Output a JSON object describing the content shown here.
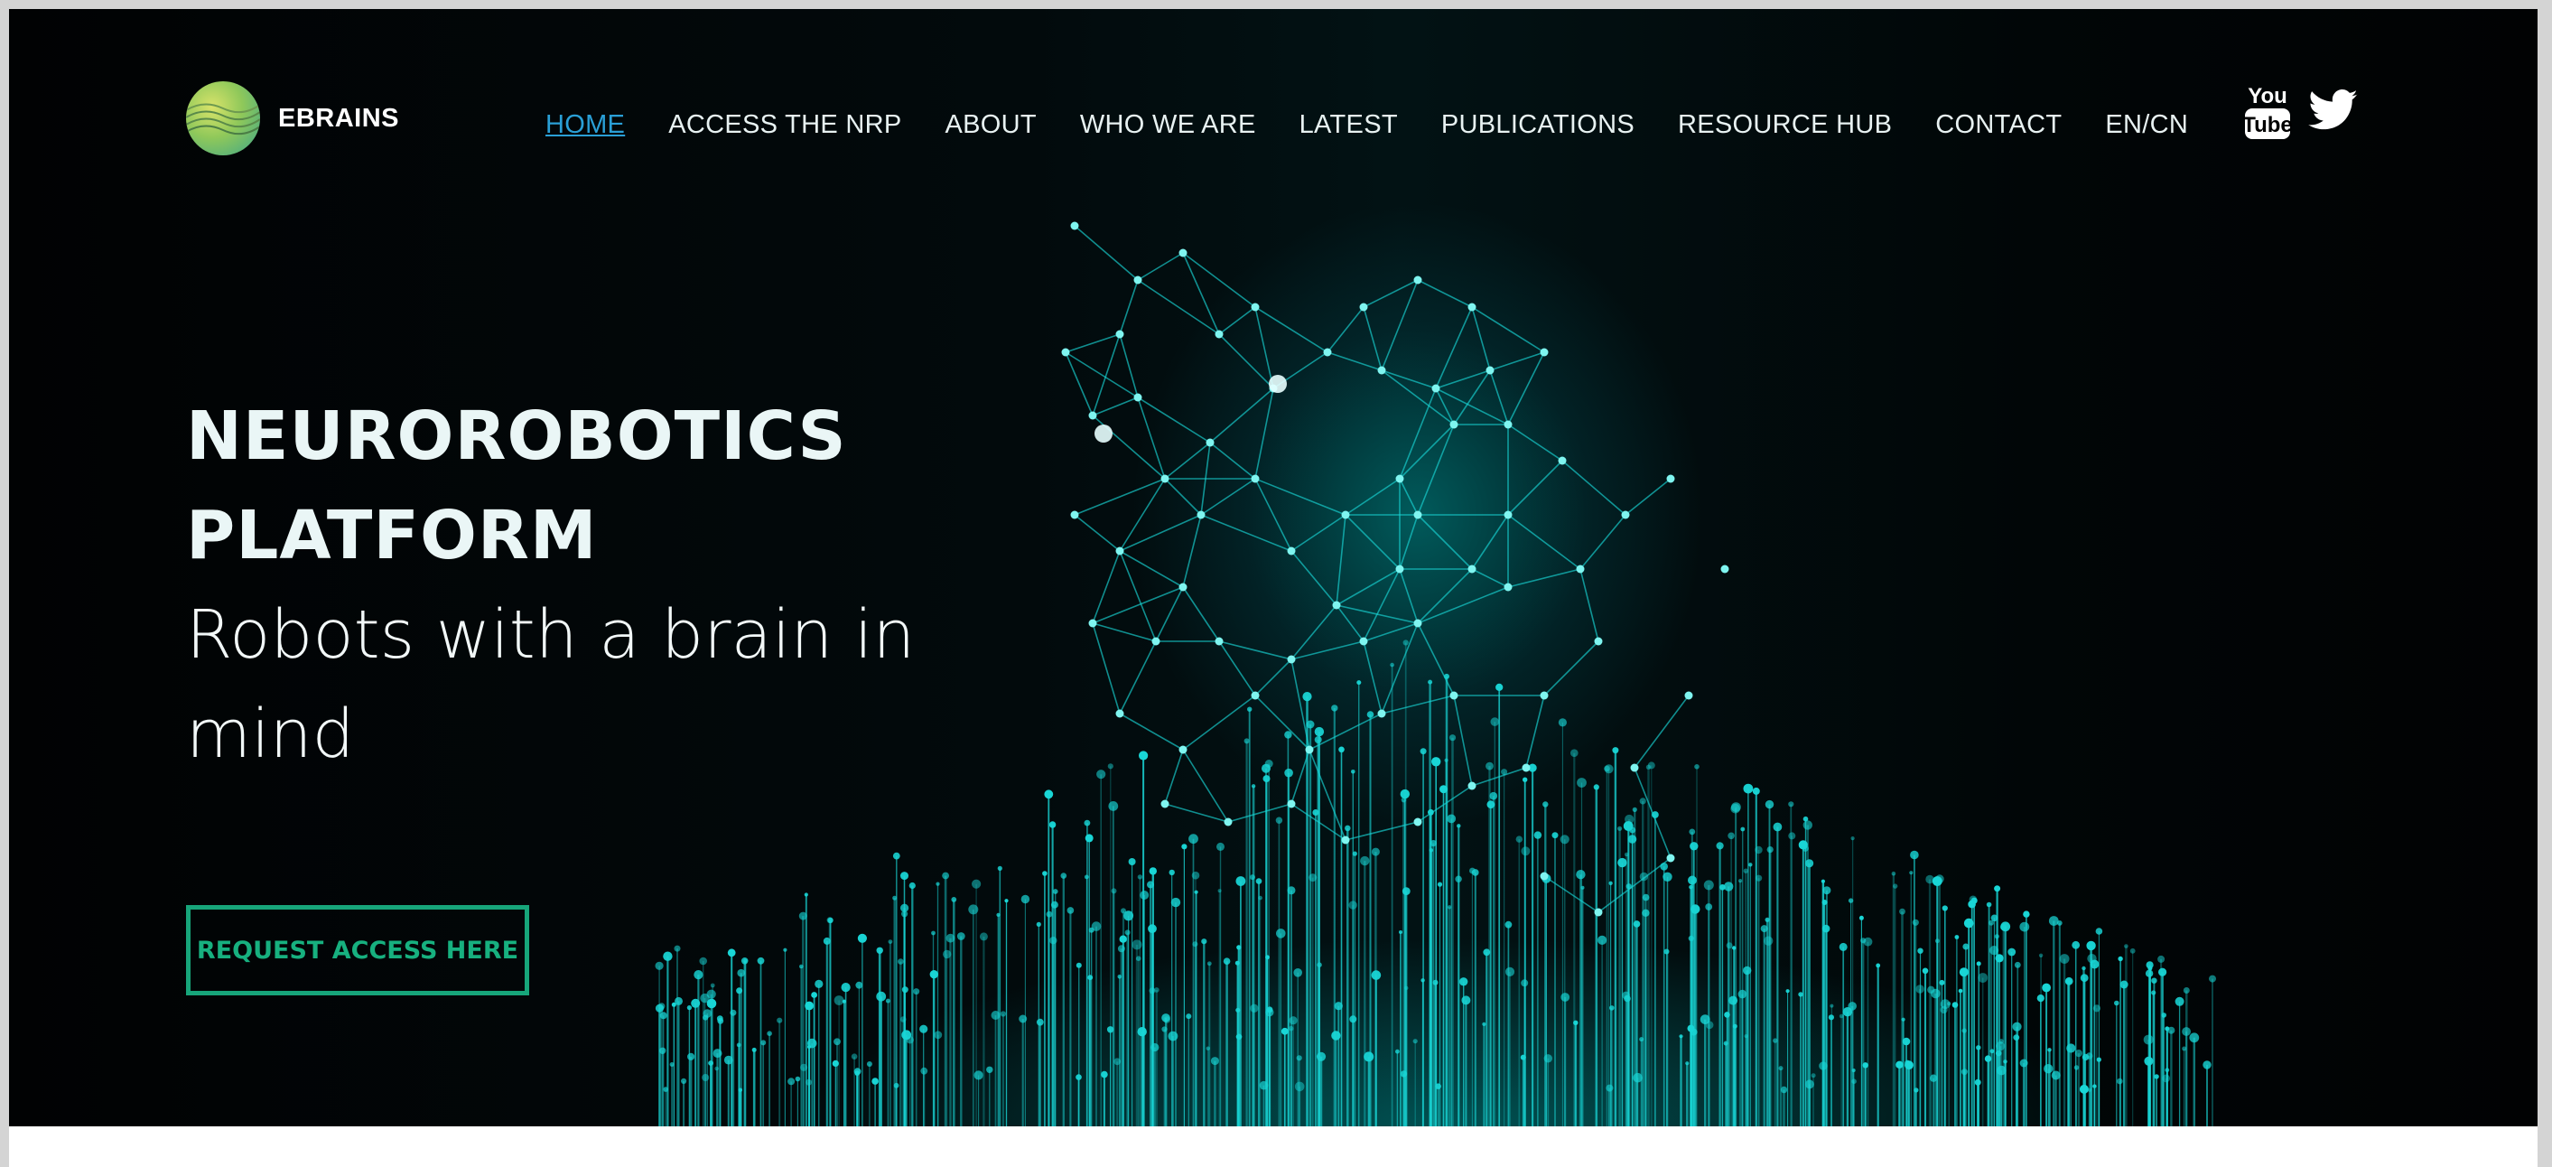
{
  "brand": {
    "name": "EBRAINS",
    "logo_icon": "ebrains-logo-icon"
  },
  "nav": {
    "items": [
      {
        "label": "HOME",
        "active": true
      },
      {
        "label": "ACCESS THE NRP",
        "active": false
      },
      {
        "label": "ABOUT",
        "active": false
      },
      {
        "label": "WHO WE ARE",
        "active": false
      },
      {
        "label": "LATEST",
        "active": false
      },
      {
        "label": "PUBLICATIONS",
        "active": false
      },
      {
        "label": "RESOURCE HUB",
        "active": false
      },
      {
        "label": "CONTACT",
        "active": false
      },
      {
        "label": "EN/CN",
        "active": false
      }
    ]
  },
  "social": {
    "youtube": {
      "icon": "youtube-icon",
      "line1": "You",
      "line2": "Tube"
    },
    "twitter": {
      "icon": "twitter-icon"
    }
  },
  "hero": {
    "title_line1": "NEUROROBOTICS",
    "title_line2": "PLATFORM",
    "subtitle": "Robots with a brain in mind",
    "cta_label": "REQUEST ACCESS HERE",
    "image": "neural-face-illustration"
  },
  "colors": {
    "accent": "#17a57a",
    "active_link": "#2a9fd6",
    "hero_bg": "#010304",
    "glow": "#19d6d6"
  }
}
